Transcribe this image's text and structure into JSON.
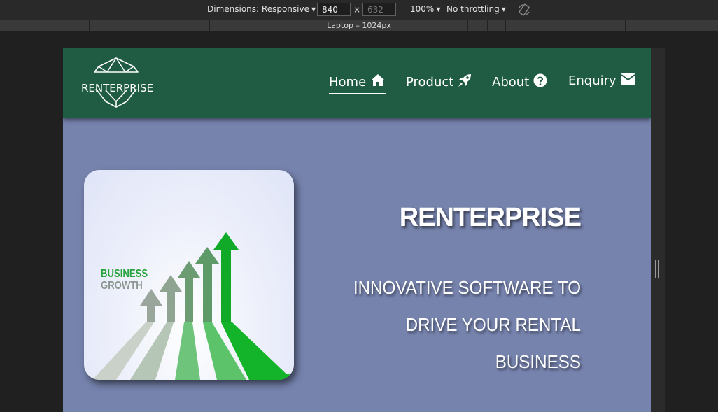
{
  "devtools": {
    "dimensions_label": "Dimensions: Responsive",
    "width_value": "840",
    "height_value": "632",
    "times_symbol": "×",
    "zoom_label": "100%",
    "throttling_label": "No throttling",
    "caret": "▼",
    "media_query_label": "Laptop – 1024px"
  },
  "site": {
    "logo_text": "RENTERPRISE",
    "nav": [
      {
        "label": "Home",
        "icon": "home-icon",
        "active": true
      },
      {
        "label": "Product",
        "icon": "rocket-icon",
        "active": false
      },
      {
        "label": "About",
        "icon": "question-circle-icon",
        "active": false
      },
      {
        "label": "Enquiry",
        "icon": "envelope-icon",
        "active": false
      }
    ],
    "hero": {
      "image_text_line1": "BUSINESS",
      "image_text_line2": "GROWTH",
      "title": "RENTERPRISE",
      "tagline_lines": [
        "INNOVATIVE SOFTWARE TO",
        "DRIVE YOUR RENTAL",
        "BUSINESS"
      ]
    }
  },
  "colors": {
    "header_bg": "#1f5c43",
    "page_bg": "#7683ad",
    "arrow_green": "#1fb02f"
  }
}
